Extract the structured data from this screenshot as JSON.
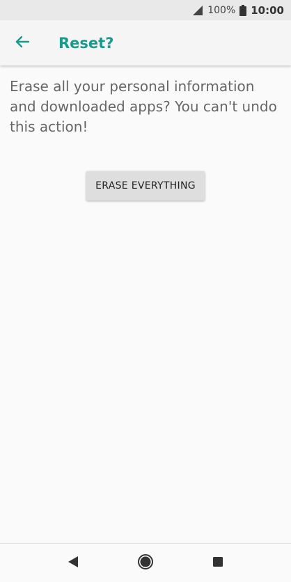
{
  "status_bar": {
    "battery_percent": "100%",
    "time": "10:00",
    "icons": [
      "signal-icon",
      "battery-icon"
    ]
  },
  "app_bar": {
    "title": "Reset?",
    "back_icon": "back-arrow-icon"
  },
  "content": {
    "message": "Erase all your personal information and downloaded apps? You can't undo this action!",
    "erase_button_label": "ERASE EVERYTHING"
  },
  "nav_bar": {
    "icons": [
      "nav-back-icon",
      "nav-home-icon",
      "nav-recents-icon"
    ]
  },
  "colors": {
    "accent": "#1a9a8c",
    "status_bar_bg": "#e9e9e9",
    "page_bg": "#fafafa",
    "button_bg": "#dedede",
    "text_gray": "#666666"
  }
}
